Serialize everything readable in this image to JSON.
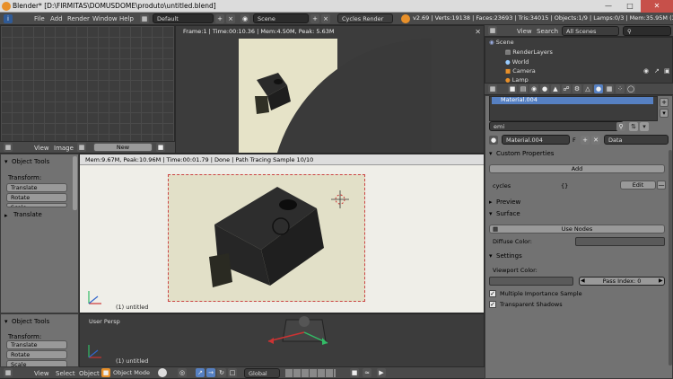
{
  "window": {
    "title": "Blender* [D:\\FIRMITAS\\DOMUSDOME\\produto\\untitled.blend]"
  },
  "topbar": {
    "menus": [
      "File",
      "Add",
      "Render",
      "Window",
      "Help"
    ],
    "layout": "Default",
    "scene": "Scene",
    "engine": "Cycles Render",
    "stats": "v2.69 | Verts:19138 | Faces:23693 | Tris:34015 | Objects:1/9 | Lamps:0/3 | Mem:35.95M (33.44M) | C"
  },
  "render_viewport": {
    "info": "Frame:1 | Time:00:10.36 | Mem:4.50M, Peak: 5.63M"
  },
  "image_editor_header": {
    "menus": [
      "View",
      "Image"
    ],
    "new_label": "New"
  },
  "camera_view": {
    "info": "Mem:9.67M, Peak:10.96M | Time:00:01.79 | Done | Path Tracing Sample 10/10",
    "object_label": "(1) untitled"
  },
  "left_toolshelf_top": {
    "header": "Object Tools",
    "transform_label": "Transform:",
    "buttons": [
      "Translate",
      "Rotate",
      "Scale"
    ],
    "operator": "Translate"
  },
  "left_toolshelf_bottom": {
    "header": "Object Tools",
    "transform_label": "Transform:",
    "buttons": [
      "Translate",
      "Rotate",
      "Scale"
    ]
  },
  "user_persp": {
    "label": "User Persp",
    "object_label": "(1) untitled"
  },
  "bottom_header": {
    "menus": [
      "View",
      "Select",
      "Object"
    ],
    "mode": "Object Mode",
    "orientation": "Global"
  },
  "outliner": {
    "menus": [
      "View",
      "Search"
    ],
    "filter": "All Scenes",
    "items": [
      "Scene",
      "RenderLayers",
      "World",
      "Camera",
      "Lamp"
    ]
  },
  "properties": {
    "material_slot": "Material.004",
    "search_value": "emi",
    "material_name": "Material.004",
    "material_flag": "F",
    "data_dropdown": "Data",
    "custom_props_header": "Custom Properties",
    "add_label": "Add",
    "cycles_label": "cycles",
    "cycles_value": "{}",
    "edit_label": "Edit",
    "preview_header": "Preview",
    "surface_header": "Surface",
    "use_nodes_label": "Use Nodes",
    "diffuse_label": "Diffuse Color:",
    "settings_header": "Settings",
    "viewport_color_label": "Viewport Color:",
    "pass_index_label": "Pass Index: 0",
    "multiple_importance_label": "Multiple Importance Sample",
    "transparent_shadows_label": "Transparent Shadows"
  },
  "colors": {
    "accent_orange": "#e8902a",
    "selection_blue": "#5680c2",
    "close_red": "#c7504a"
  }
}
